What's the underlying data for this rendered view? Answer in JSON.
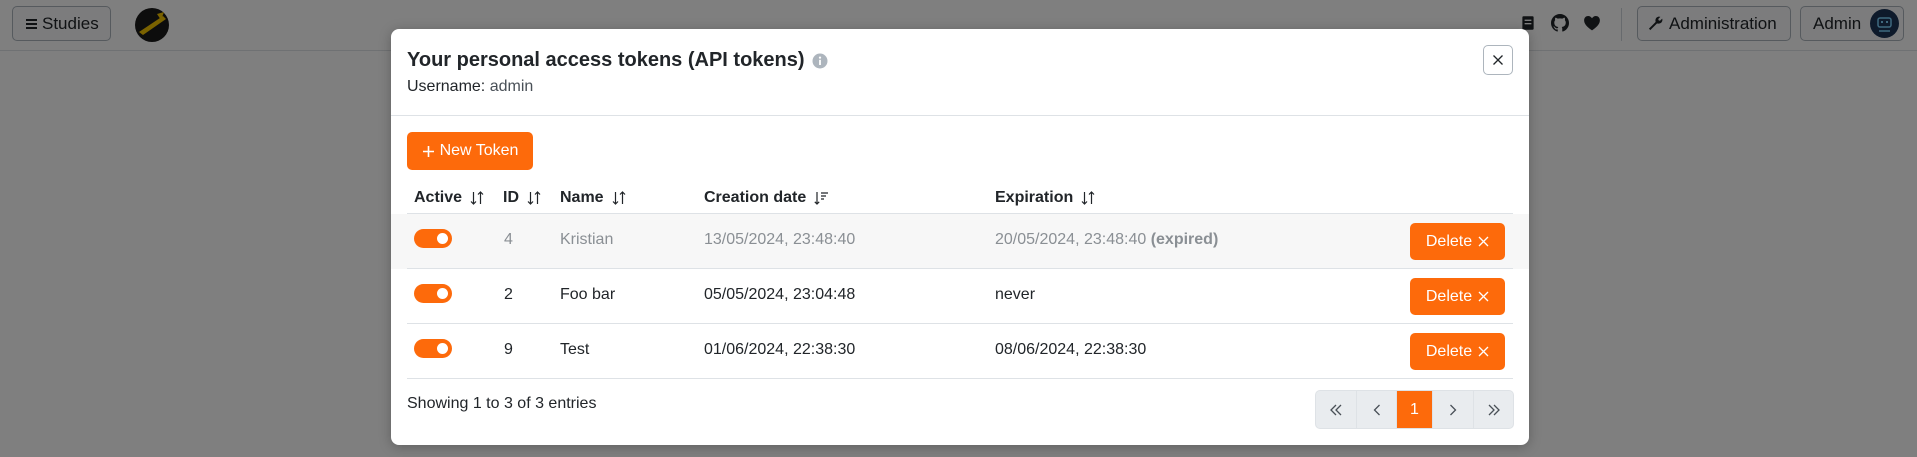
{
  "navbar": {
    "studies_label": "Studies",
    "administration_label": "Administration",
    "user_label": "Admin",
    "icons": [
      "book-icon",
      "github-icon",
      "heart-icon",
      "wrench-icon"
    ]
  },
  "modal": {
    "title": "Your personal access tokens (API tokens)",
    "username_label": "Username:",
    "username_value": "admin",
    "new_token_label": "New Token",
    "columns": {
      "active": "Active",
      "id": "ID",
      "name": "Name",
      "creation": "Creation date",
      "expiration": "Expiration"
    },
    "rows": [
      {
        "active": true,
        "id": "4",
        "name": "Kristian",
        "creation": "13/05/2024, 23:48:40",
        "expiration": "20/05/2024, 23:48:40",
        "expired_tag": "(expired)",
        "delete_label": "Delete"
      },
      {
        "active": true,
        "id": "2",
        "name": "Foo bar",
        "creation": "05/05/2024, 23:04:48",
        "expiration": "never",
        "expired_tag": "",
        "delete_label": "Delete"
      },
      {
        "active": true,
        "id": "9",
        "name": "Test",
        "creation": "01/06/2024, 22:38:30",
        "expiration": "08/06/2024, 22:38:30",
        "expired_tag": "",
        "delete_label": "Delete"
      }
    ],
    "footer_info": "Showing 1 to 3 of 3 entries",
    "pagination": {
      "current_page": "1"
    }
  },
  "colors": {
    "accent": "#fd6a0b",
    "backdrop": "rgba(0,0,0,0.5)"
  }
}
